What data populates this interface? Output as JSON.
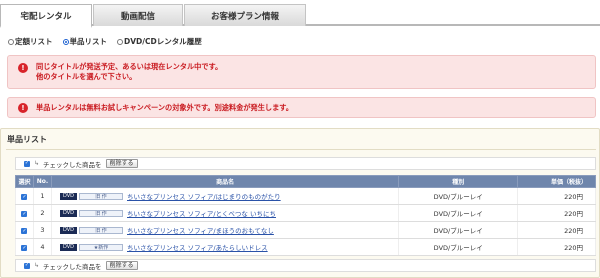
{
  "tabs": [
    {
      "label": "宅配レンタル",
      "active": true
    },
    {
      "label": "動画配信",
      "active": false
    },
    {
      "label": "お客様プラン情報",
      "active": false
    }
  ],
  "list_types": [
    {
      "label": "定額リスト",
      "selected": false
    },
    {
      "label": "単品リスト",
      "selected": true
    },
    {
      "label": "DVD/CDレンタル履歴",
      "selected": false
    }
  ],
  "alerts": {
    "first": {
      "line1": "同じタイトルが発送予定、あるいは現在レンタル中です。",
      "line2": "他のタイトルを選んで下さい。"
    },
    "second": {
      "line1": "単品レンタルは無料お試しキャンペーンの対象外です。別途料金が発生します。"
    }
  },
  "section": {
    "title": "単品リスト",
    "action_text": "チェックした商品を",
    "delete_button": "削除する"
  },
  "table": {
    "headers": {
      "select": "選択",
      "no": "No.",
      "title": "商品名",
      "type": "種別",
      "price": "単価（税抜）"
    },
    "rows": [
      {
        "no": "1",
        "format": "DVD",
        "status": "旧 作",
        "title": "ちいさなプリンセス ソフィア/はじまりのものがたり",
        "type": "DVD/ブルーレイ",
        "price": "220円"
      },
      {
        "no": "2",
        "format": "DVD",
        "status": "旧 作",
        "title": "ちいさなプリンセス ソフィア/とくべつな いちにち",
        "type": "DVD/ブルーレイ",
        "price": "220円"
      },
      {
        "no": "3",
        "format": "DVD",
        "status": "旧 作",
        "title": "ちいさなプリンセス ソフィア/まほうのおもてなし",
        "type": "DVD/ブルーレイ",
        "price": "220円"
      },
      {
        "no": "4",
        "format": "DVD",
        "status": "★新作",
        "title": "ちいさなプリンセス ソフィア/あたらしいドレス",
        "type": "DVD/ブルーレイ",
        "price": "220円"
      }
    ]
  },
  "colors": {
    "alert_text": "#c9191f",
    "alert_bg": "#fbe4e4",
    "table_header": "#6f86ac",
    "link": "#2a52a8",
    "checkbox": "#2b73d6"
  }
}
